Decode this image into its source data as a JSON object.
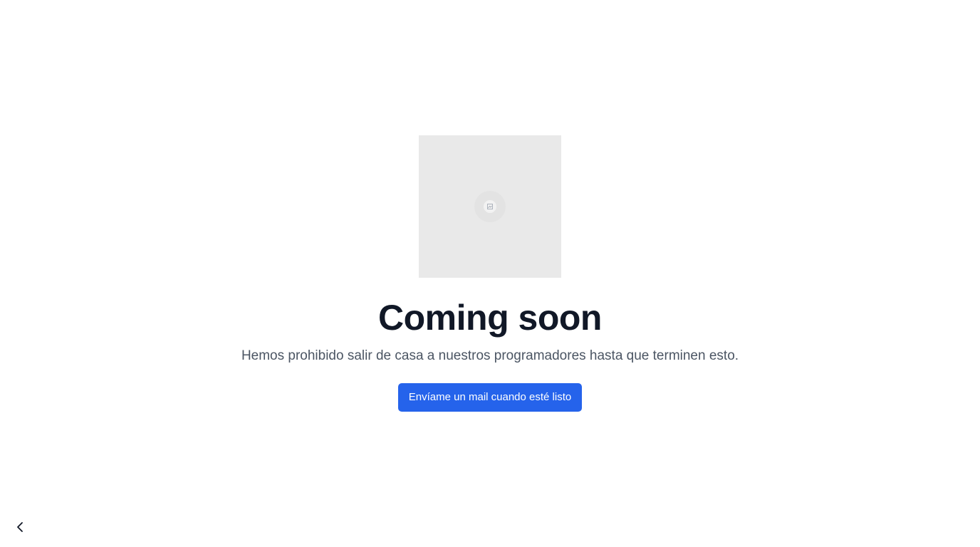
{
  "hero": {
    "image_icon": "image-placeholder-icon",
    "title": "Coming soon",
    "subtitle": "Hemos prohibido salir de casa a nuestros programadores hasta que terminen esto."
  },
  "cta": {
    "label": "Envíame un mail cuando esté listo",
    "color": "#2563eb"
  },
  "nav": {
    "back_icon": "chevron-left-icon"
  },
  "colors": {
    "title": "#111827",
    "subtitle": "#4b5563",
    "placeholder_bg": "#e9e9e9"
  }
}
